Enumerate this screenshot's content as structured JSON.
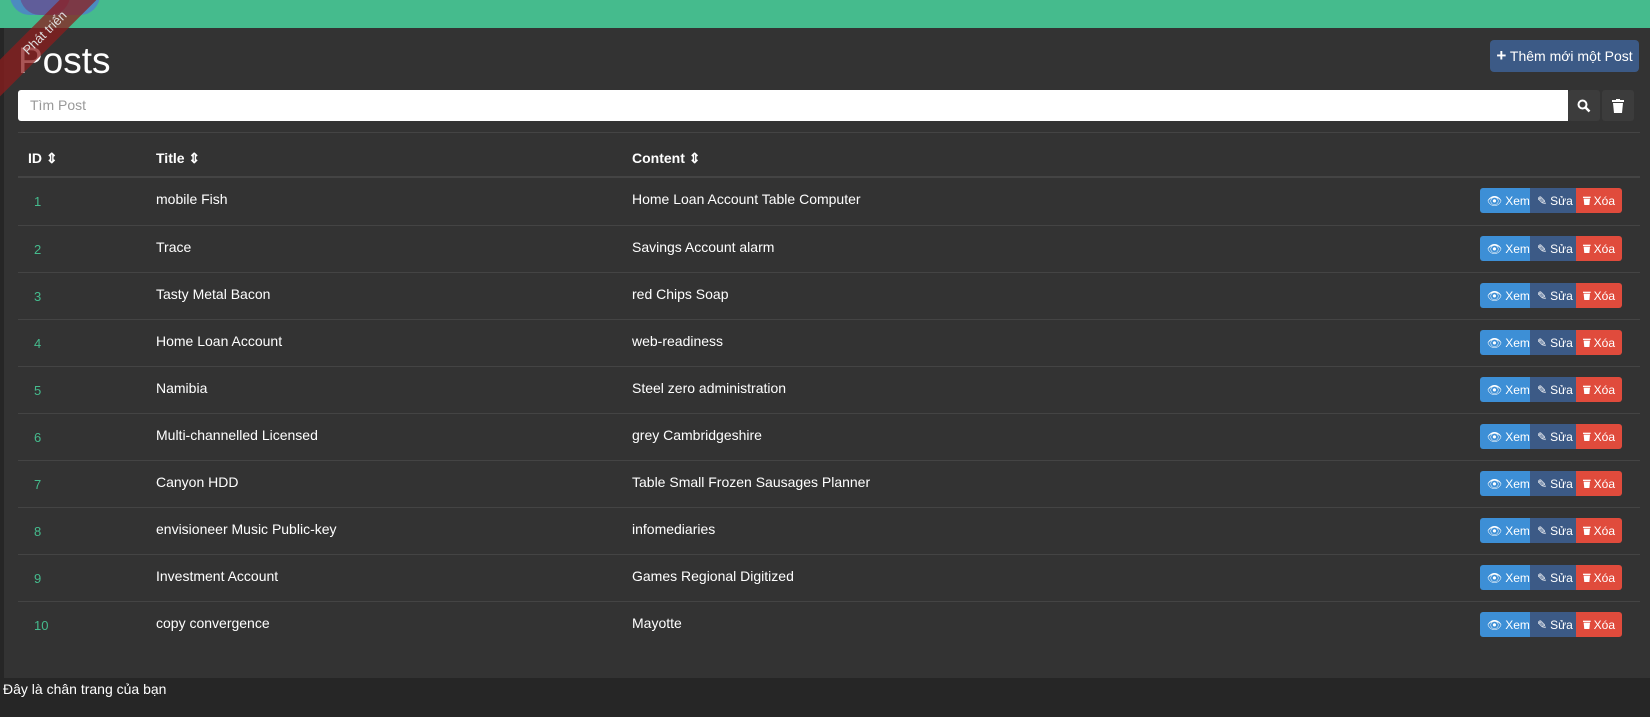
{
  "header": {
    "ribbon": "Phát triển"
  },
  "page": {
    "title": "Posts",
    "add_button": "Thêm mới một Post"
  },
  "search": {
    "placeholder": "Tìm Post",
    "search_icon": "search-icon",
    "clear_icon": "trash-icon"
  },
  "table": {
    "columns": [
      "ID",
      "Title",
      "Content"
    ],
    "actions": {
      "view": "Xem",
      "edit": "Sửa",
      "delete": "Xóa"
    },
    "rows": [
      {
        "id": "1",
        "title": "mobile Fish",
        "content": "Home Loan Account Table Computer"
      },
      {
        "id": "2",
        "title": "Trace",
        "content": "Savings Account alarm"
      },
      {
        "id": "3",
        "title": "Tasty Metal Bacon",
        "content": "red Chips Soap"
      },
      {
        "id": "4",
        "title": "Home Loan Account",
        "content": "web-readiness"
      },
      {
        "id": "5",
        "title": "Namibia",
        "content": "Steel zero administration"
      },
      {
        "id": "6",
        "title": "Multi-channelled Licensed",
        "content": "grey Cambridgeshire"
      },
      {
        "id": "7",
        "title": "Canyon HDD",
        "content": "Table Small Frozen Sausages Planner"
      },
      {
        "id": "8",
        "title": "envisioneer Music Public-key",
        "content": "infomediaries"
      },
      {
        "id": "9",
        "title": "Investment Account",
        "content": "Games Regional Digitized"
      },
      {
        "id": "10",
        "title": "copy convergence",
        "content": "Mayotte"
      }
    ]
  },
  "footer": {
    "text": "Đây là chân trang của bạn"
  },
  "colors": {
    "accent": "#45bb8d",
    "view": "#3d8fd6",
    "edit": "#3c5a86",
    "delete": "#e04b3c"
  }
}
